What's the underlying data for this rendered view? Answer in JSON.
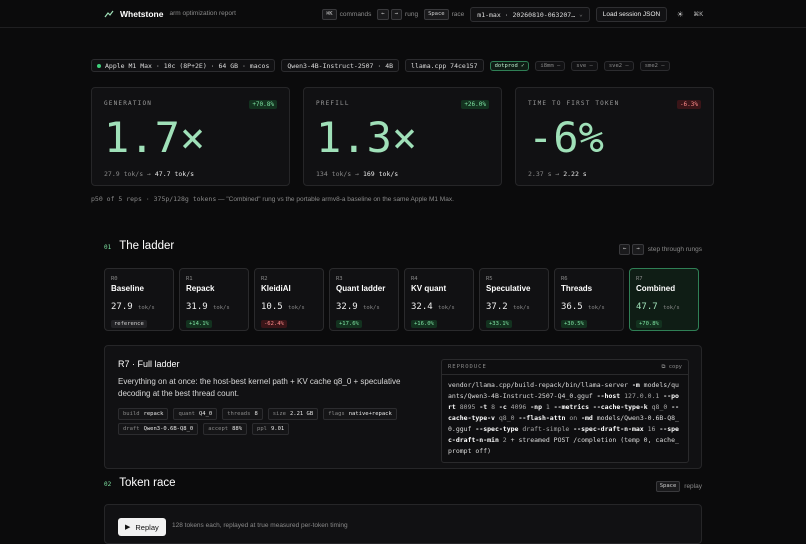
{
  "app": {
    "brand": "Whetstone",
    "subtitle": "arm optimization report"
  },
  "topbar": {
    "kbd_cmd": "⌘K",
    "cmd_label": "commands",
    "kbd_left": "←",
    "kbd_right": "→",
    "rung_label": "rung",
    "kbd_space": "Space",
    "race_label": "race",
    "run_select": "m1-max · 20260810-063207…",
    "load_button": "Load session JSON",
    "theme_icon": "sun-icon",
    "shortcut_label": "⌘K"
  },
  "chips": {
    "machine": "Apple M1 Max · 10c (8P+2E) · 64 GB · macos",
    "model": "Qwen3-4B-Instruct-2507 · 4B",
    "engine": "llama.cpp 74ce157",
    "features": [
      "dotprod ✓",
      "i8mm –",
      "sve –",
      "sve2 –",
      "sme2 –"
    ]
  },
  "metrics": [
    {
      "label": "GENERATION",
      "delta": "+70.8%",
      "big": "1.7×",
      "from": "27.9 tok/s",
      "to": "47.7 tok/s",
      "tone": "pos"
    },
    {
      "label": "PREFILL",
      "delta": "+26.0%",
      "big": "1.3×",
      "from": "134 tok/s",
      "to": "169 tok/s",
      "tone": "pos"
    },
    {
      "label": "TIME TO FIRST TOKEN",
      "delta": "-6.3%",
      "big": "-6%",
      "from": "2.37 s",
      "to": "2.22 s",
      "tone": "neg"
    }
  ],
  "note": {
    "prefix": "p50 of 5 reps · 375p/128g tokens",
    "rest": " — \"Combined\" rung vs the portable armv8-a baseline on the same Apple M1 Max."
  },
  "ladder": {
    "num": "01",
    "title": "The ladder",
    "step_hint": "step through rungs",
    "rungs": [
      {
        "key": "R0",
        "name": "Baseline",
        "value": "27.9",
        "unit": "tok/s",
        "badge": "reference",
        "tone": "ref"
      },
      {
        "key": "R1",
        "name": "Repack",
        "value": "31.9",
        "unit": "tok/s",
        "badge": "+14.1%",
        "tone": "pos"
      },
      {
        "key": "R2",
        "name": "KleidiAI",
        "value": "10.5",
        "unit": "tok/s",
        "badge": "-62.4%",
        "tone": "neg"
      },
      {
        "key": "R3",
        "name": "Quant ladder",
        "value": "32.9",
        "unit": "tok/s",
        "badge": "+17.6%",
        "tone": "pos"
      },
      {
        "key": "R4",
        "name": "KV quant",
        "value": "32.4",
        "unit": "tok/s",
        "badge": "+16.0%",
        "tone": "pos"
      },
      {
        "key": "R5",
        "name": "Speculative",
        "value": "37.2",
        "unit": "tok/s",
        "badge": "+33.1%",
        "tone": "pos"
      },
      {
        "key": "R6",
        "name": "Threads",
        "value": "36.5",
        "unit": "tok/s",
        "badge": "+30.5%",
        "tone": "pos"
      },
      {
        "key": "R7",
        "name": "Combined",
        "value": "47.7",
        "unit": "tok/s",
        "badge": "+70.8%",
        "tone": "pos",
        "selected": true
      }
    ]
  },
  "detail": {
    "title": "R7 · Full ladder",
    "desc": "Everything on at once: the host-best kernel path + KV cache q8_0 + speculative decoding at the best thread count.",
    "tags1": [
      {
        "k": "build",
        "v": "repack"
      },
      {
        "k": "quant",
        "v": "Q4_0"
      },
      {
        "k": "threads",
        "v": "8"
      },
      {
        "k": "size",
        "v": "2.21 GB"
      },
      {
        "k": "flags",
        "v": "native+repack"
      }
    ],
    "tags2": [
      {
        "k": "draft",
        "v": "Qwen3-0.6B-Q8_0"
      },
      {
        "k": "accept",
        "v": "88%"
      },
      {
        "k": "ppl",
        "v": "9.01"
      }
    ],
    "repro_label": "REPRODUCE",
    "copy_label": "copy"
  },
  "race": {
    "num": "02",
    "title": "Token race",
    "kbd": "Space",
    "hint": "replay",
    "button": "Replay",
    "note": "128 tokens each, replayed at true measured per-token timing"
  }
}
